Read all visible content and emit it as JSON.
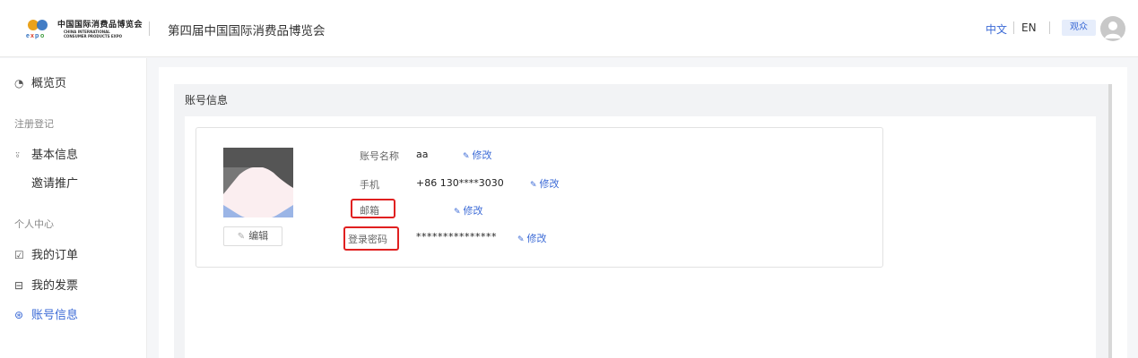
{
  "header": {
    "logo_cn": "中国国际消费品博览会",
    "logo_en_line1": "CHINA INTERNATIONAL",
    "logo_en_line2": "CONSUMER PRODUCTS EXPO",
    "site_title": "第四届中国国际消费品博览会",
    "lang_zh": "中文",
    "lang_en": "EN",
    "role": "观众"
  },
  "sidebar": {
    "overview": "概览页",
    "group_register": "注册登记",
    "basic_info": "基本信息",
    "invite": "邀请推广",
    "group_personal": "个人中心",
    "my_orders": "我的订单",
    "my_invoices": "我的发票",
    "account_info": "账号信息"
  },
  "panel": {
    "title": "账号信息"
  },
  "account": {
    "edit_label": "编辑",
    "rows": [
      {
        "label": "账号名称",
        "value": "aa",
        "action": "修改"
      },
      {
        "label": "手机",
        "value": "+86 130****3030",
        "action": "修改"
      },
      {
        "label": "邮箱",
        "value": "",
        "action": "修改"
      },
      {
        "label": "登录密码",
        "value": "***************",
        "action": "修改"
      }
    ]
  },
  "colors": {
    "accent": "#3b6ad6",
    "highlight": "#e02020"
  }
}
